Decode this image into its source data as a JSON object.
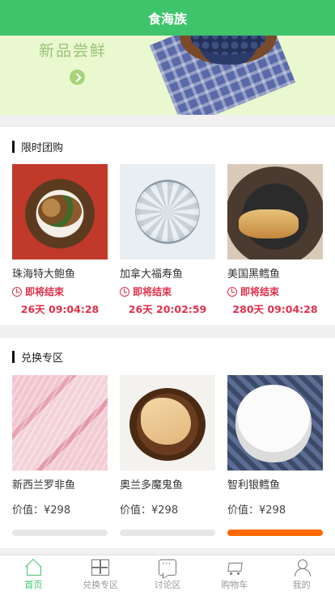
{
  "header": {
    "title": "食海族"
  },
  "banner": {
    "slogan": "新品尝鲜",
    "arrow_icon": "chevron-right-circle-icon"
  },
  "flash_sale": {
    "title": "限时团购",
    "items": [
      {
        "name": "珠海特大鲍鱼",
        "status": "即将结束",
        "countdown": "26天 09:04:28"
      },
      {
        "name": "加拿大福寿鱼",
        "status": "即将结束",
        "countdown": "26天 20:02:59"
      },
      {
        "name": "美国黑鳕鱼",
        "status": "即将结束",
        "countdown": "280天 09:04:28"
      }
    ]
  },
  "exchange": {
    "title": "兑换专区",
    "price_prefix": "价值：",
    "items": [
      {
        "name": "新西兰罗非鱼",
        "price": "¥298",
        "progress": 0
      },
      {
        "name": "奥兰多魔鬼鱼",
        "price": "¥298",
        "progress": 0
      },
      {
        "name": "智利银鳕鱼",
        "price": "¥298",
        "progress": 1
      }
    ]
  },
  "tabbar": {
    "tabs": [
      {
        "label": "首页",
        "icon": "home-icon",
        "active": true
      },
      {
        "label": "兑换专区",
        "icon": "grid-icon",
        "active": false
      },
      {
        "label": "讨论区",
        "icon": "chat-icon",
        "active": false
      },
      {
        "label": "购物车",
        "icon": "cart-icon",
        "active": false
      },
      {
        "label": "我的",
        "icon": "user-icon",
        "active": false
      }
    ]
  },
  "colors": {
    "primary": "#3fc46b",
    "alert": "#e0304a",
    "progress": "#ff6a00"
  }
}
